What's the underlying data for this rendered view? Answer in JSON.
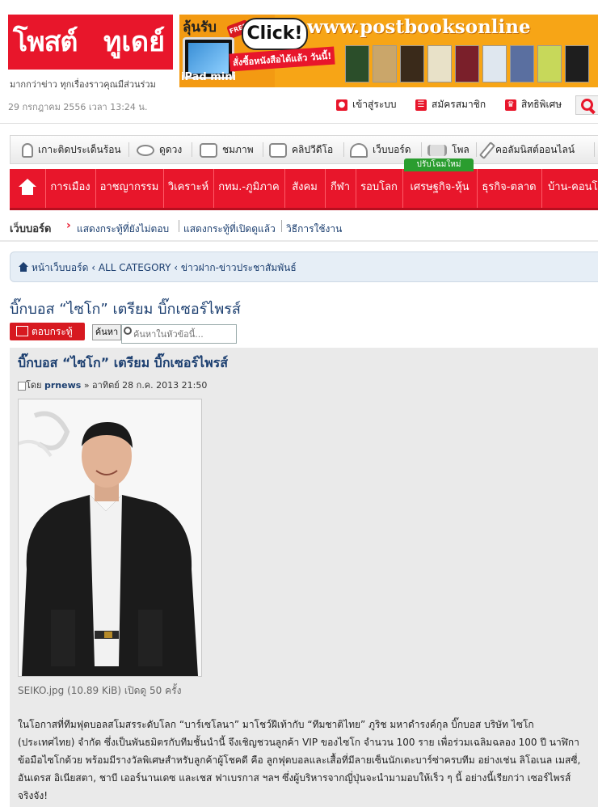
{
  "header": {
    "logo_text_1": "โพสต์",
    "logo_text_2": "ทูเดย์",
    "tagline": "มากกว่าข่าว ทุกเรื่องราวคุณมีส่วนร่วม",
    "datetime": "29 กรกฎาคม 2556 เวลา 13:24 น.",
    "links": [
      {
        "label": "เข้าสู่ระบบ",
        "icon": "lock-icon"
      },
      {
        "label": "สมัครสมาชิก",
        "icon": "form-icon"
      },
      {
        "label": "สิทธิพิเศษ",
        "icon": "crown-icon"
      }
    ]
  },
  "banner": {
    "lun_rub": "ลุ้นรับ",
    "free": "FREE",
    "ipad": "iPad mini",
    "click": "Click!",
    "order": "สั่งซื้อหนังสือได้แล้ว วันนี้!",
    "url": "www.postbooksonline"
  },
  "nav_secondary": [
    {
      "label": "เกาะติดประเด็นร้อน",
      "icon": "fire-icon"
    },
    {
      "label": "ดูดวง",
      "icon": "eye-icon"
    },
    {
      "label": "ชมภาพ",
      "icon": "camera-icon"
    },
    {
      "label": "คลิปวีดีโอ",
      "icon": "video-icon"
    },
    {
      "label": "เว็บบอร์ด",
      "icon": "webboard-icon"
    },
    {
      "label": "โพล",
      "icon": "poll-icon"
    },
    {
      "label": "คอลัมนิสต์ออนไลน์",
      "icon": "pen-icon"
    }
  ],
  "nav_main": {
    "update_badge": "ปรับโฉมใหม่",
    "items": [
      "การเมือง",
      "อาชญากรรม",
      "วิเคราะห์",
      "กทม.-ภูมิภาค",
      "สังคม",
      "กีฬา",
      "รอบโลก",
      "เศรษฐกิจ-หุ้น",
      "ธุรกิจ-ตลาด",
      "บ้าน-คอนโด"
    ]
  },
  "webboard": {
    "title": "เว็บบอร์ด",
    "links": [
      "แสดงกระทู้ที่ยังไม่ตอบ",
      "แสดงกระทู้ที่เปิดดูแล้ว",
      "วิธีการใช้งาน"
    ]
  },
  "breadcrumb": {
    "home": "หน้าเว็บบอร์ด",
    "path": [
      "ALL CATEGORY",
      "ข่าวฝาก-ข่าวประชาสัมพันธ์"
    ]
  },
  "topic": {
    "title": "บิ๊กบอส “ไซโก” เตรียม บิ๊กเซอร์ไพรส์",
    "reply_label": "ตอบกระทู้",
    "search_label": "ค้นหา",
    "search_placeholder": "ค้นหาในหัวข้อนี้..."
  },
  "post": {
    "title": "บิ๊กบอส “ไซโก” เตรียม บิ๊กเซอร์ไพรส์",
    "by": "โดย",
    "author": "prnews",
    "date": "» อาทิตย์ 28 ก.ค. 2013 21:50",
    "attachment": "SEIKO.jpg (10.89 KiB) เปิดดู 50 ครั้ง",
    "body": "ในโอกาสที่ทีมฟุตบอลสโมสรระดับโลก “บาร์เซโลนา” มาโชว์ฝีเท้ากับ “ทีมชาติไทย” ภูริช มหาดำรงค์กุล บิ๊กบอส บริษัท ไซโก (ประเทศไทย) จำกัด ซึ่งเป็นพันธมิตรกับทีมชั้นนำนี้ จึงเชิญชวนลูกค้า VIP ของไซโก จำนวน 100 ราย เพื่อร่วมเฉลิมฉลอง 100 ปี นาฬิกาข้อมือไซโกด้วย พร้อมมีรางวัลพิเศษสำหรับลูกค้าผู้โชคดี คือ ลูกฟุตบอลและเสื้อที่มีลายเซ็นนักเตะบาร์ซ่าครบทีม อย่างเช่น ลิโอเนล เมสซี่, อันเดรส อิเนียสตา, ชาบี เออร์นานเดซ และเชส ฟาเบรกาส ฯลฯ ซึ่งผู้บริหารจากญี่ปุ่นจะนำมามอบให้เร็ว ๆ นี้ อย่างนี้เรียกว่า เซอร์ไพรส์จริงจัง!"
  },
  "colors": {
    "brand_red": "#e8162b",
    "link_blue": "#1c3f70",
    "badge_green": "#2a9d2f"
  }
}
